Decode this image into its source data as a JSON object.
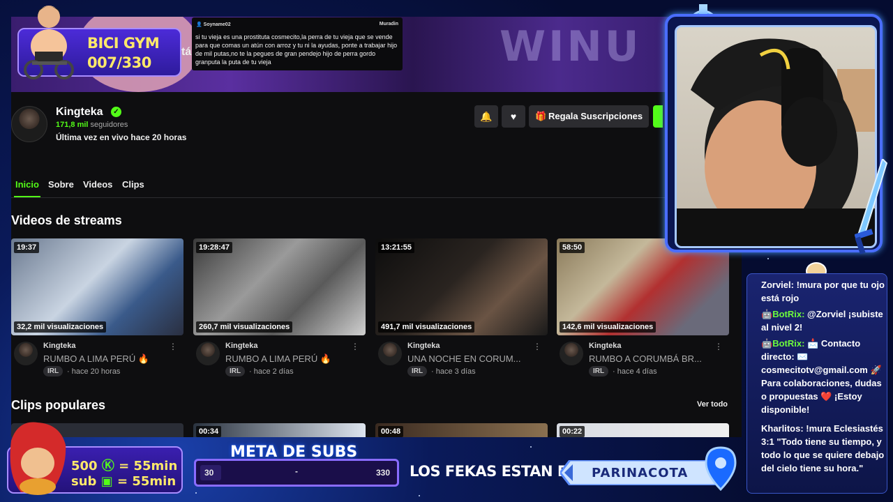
{
  "page": {
    "channel_name": "Kingteka",
    "followers_count": "171,8 mil",
    "followers_label": "seguidores",
    "last_live": "Última vez en vivo hace 20 horas",
    "gift_button": "Regala Suscripciones",
    "tabs": [
      "Inicio",
      "Sobre",
      "Videos",
      "Clips"
    ],
    "active_tab": "Inicio",
    "section_streams": "Videos de streams",
    "section_clips": "Clips populares",
    "see_all": "Ver todo",
    "videos": [
      {
        "duration": "19:37",
        "views": "32,2 mil visualizaciones",
        "author": "Kingteka",
        "title": "RUMBO A LIMA PERÚ 🔥",
        "tag": "IRL",
        "ago": "· hace 20 horas"
      },
      {
        "duration": "19:28:47",
        "views": "260,7 mil visualizaciones",
        "author": "Kingteka",
        "title": "RUMBO A LIMA PERÚ 🔥",
        "tag": "IRL",
        "ago": "· hace 2 días"
      },
      {
        "duration": "13:21:55",
        "views": "491,7 mil visualizaciones",
        "author": "Kingteka",
        "title": "UNA NOCHE EN CORUM...",
        "tag": "IRL",
        "ago": "· hace 3 días"
      },
      {
        "duration": "58:50",
        "views": "142,6 mil visualizaciones",
        "author": "Kingteka",
        "title": "RUMBO A CORUMBÁ BR...",
        "tag": "IRL",
        "ago": "· hace 4 días"
      }
    ],
    "clips": [
      {
        "duration": ""
      },
      {
        "duration": "00:34"
      },
      {
        "duration": "00:48"
      },
      {
        "duration": "00:22"
      }
    ],
    "colors": {
      "accent": "#53fc18",
      "bg": "#0e0e10",
      "button": "#2c2c30"
    }
  },
  "overlay": {
    "bici_title": "BICI GYM",
    "bici_count": "007/330",
    "message": {
      "from": "Soyname02",
      "to": "Muradin",
      "text": "si tu vieja es una prostituta cosmecito,la perra de tu vieja que se vende para que comas un atún con arroz y tu ni la ayudas, ponte a trabajar hijo de mil putas,no te la pegues de gran pendejo hijo de perra gordo granputa la puta de tu vieja"
    },
    "subs_line1": "500",
    "subs_line1_suffix": "= 55min",
    "subs_line2": "sub",
    "subs_line2_suffix": "= 55min",
    "meta_title": "META DE SUBS",
    "meta_current": "30",
    "meta_mid": "-",
    "meta_goal": "330",
    "meta_progress": 0.09,
    "fekas": "LOS FEKAS ESTAN EN:",
    "location": "PARINACOTA"
  },
  "chat": [
    {
      "user": "Zorviel:",
      "text": " !mura por que tu ojo está rojo",
      "bot": false
    },
    {
      "user": "BotRix:",
      "text": " @Zorviel ¡subiste al nivel 2!",
      "bot": true
    },
    {
      "user": "BotRix:",
      "text": " 📩 Contacto directo: ✉️ cosmecitotv@gmail.com 🚀 Para colaboraciones, dudas o propuestas ❤️ ¡Estoy disponible!",
      "bot": true
    },
    {
      "user": "Kharlitos:",
      "text": " !mura Eclesiastés 3:1 \"Todo tiene su tiempo, y todo lo que se quiere debajo del cielo tiene su hora.\"",
      "bot": false
    }
  ]
}
